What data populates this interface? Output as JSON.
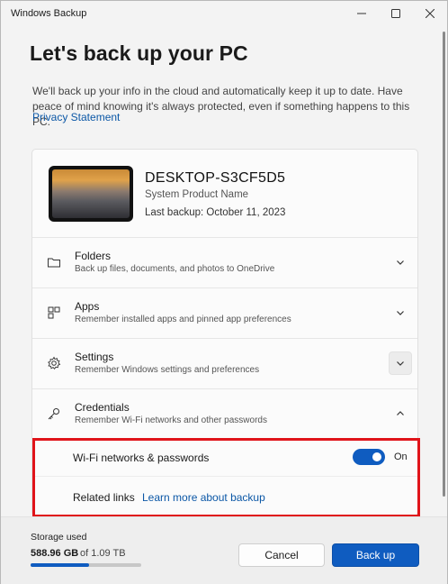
{
  "window": {
    "title": "Windows Backup"
  },
  "page": {
    "heading": "Let's back up your PC",
    "intro": "We'll back up your info in the cloud and automatically keep it up to date. Have peace of mind knowing it's always protected, even if something happens to this PC.",
    "privacy_link": "Privacy Statement"
  },
  "device": {
    "name": "DESKTOP-S3CF5D5",
    "model": "System Product Name",
    "last_backup": "Last backup: October 11, 2023"
  },
  "sections": [
    {
      "icon": "folder-icon",
      "title": "Folders",
      "description": "Back up files, documents, and photos to OneDrive",
      "state": "collapsed"
    },
    {
      "icon": "apps-icon",
      "title": "Apps",
      "description": "Remember installed apps and pinned app preferences",
      "state": "collapsed"
    },
    {
      "icon": "gear-icon",
      "title": "Settings",
      "description": "Remember Windows settings and preferences",
      "state": "collapsed"
    },
    {
      "icon": "key-icon",
      "title": "Credentials",
      "description": "Remember Wi-Fi networks and other passwords",
      "state": "expanded"
    }
  ],
  "credentials": {
    "wifi_label": "Wi-Fi networks & passwords",
    "wifi_toggle": "On",
    "wifi_enabled": true,
    "related_label": "Related links",
    "related_link": "Learn more about backup"
  },
  "footer": {
    "storage_label": "Storage used",
    "used": "588.96 GB",
    "total": "of 1.09 TB",
    "fraction_used": 0.53,
    "cancel_label": "Cancel",
    "primary_label": "Back up"
  },
  "colors": {
    "accent": "#0f5cc0",
    "link": "#0b57a6",
    "highlight": "#e0141a"
  }
}
